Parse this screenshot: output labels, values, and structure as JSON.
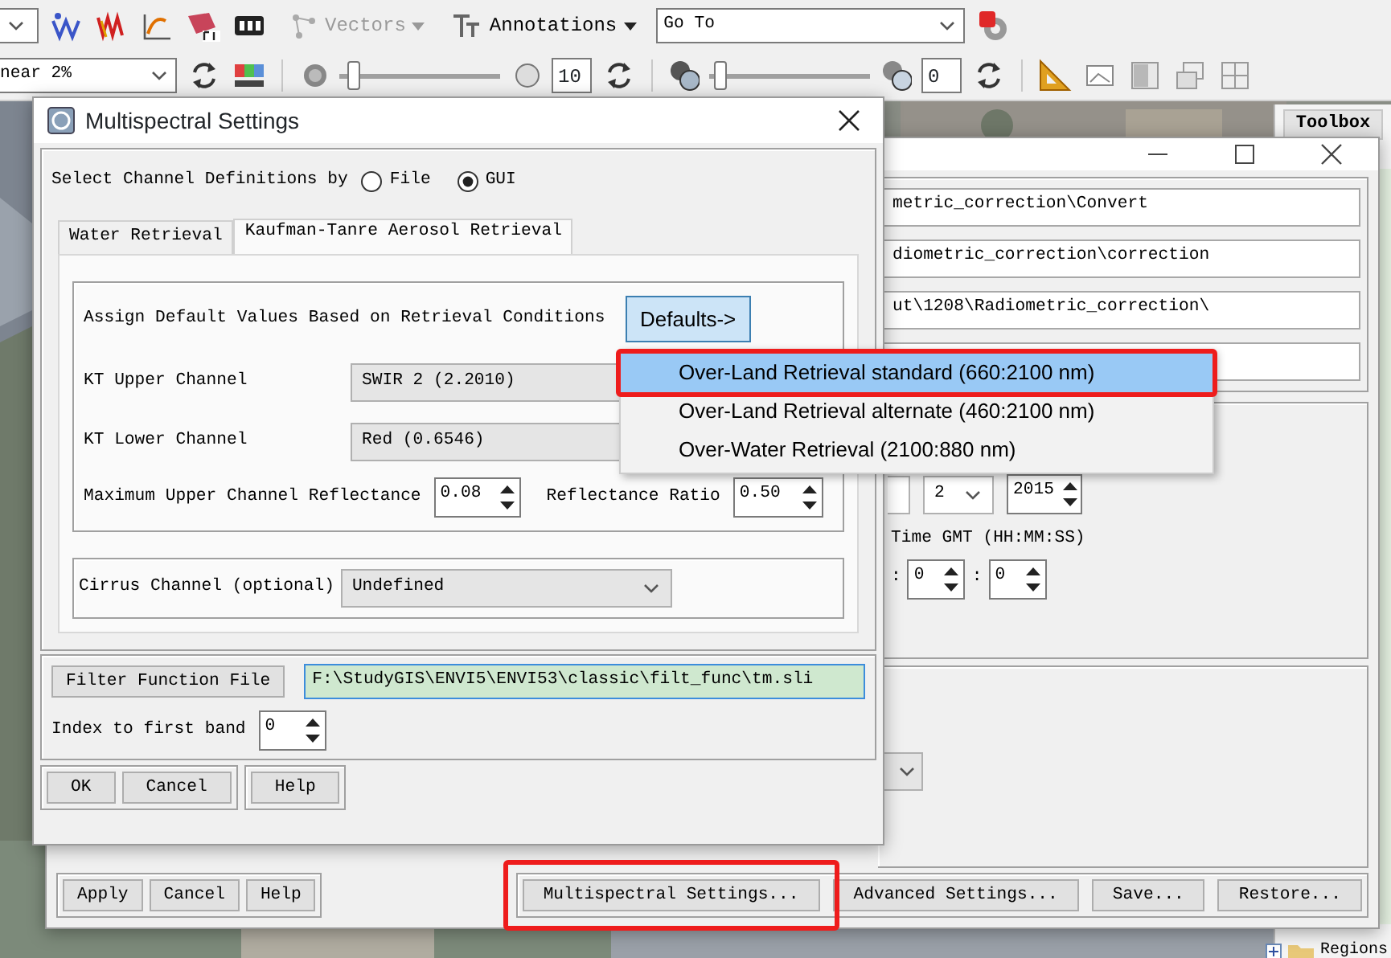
{
  "toolbar": {
    "row1": {
      "vectors": {
        "label": "Vectors",
        "disabled": true
      },
      "annotations": {
        "label": "Annotations",
        "disabled": false
      },
      "goto": {
        "value": "Go To"
      }
    },
    "row2": {
      "stretch": {
        "value": "near 2%"
      },
      "sliders": [
        {
          "level": 0.05,
          "value": "10"
        },
        {
          "level": 0.03,
          "value": "0"
        }
      ]
    }
  },
  "toolbox": {
    "title": "Toolbox",
    "items": [
      {
        "label": "Regions"
      }
    ]
  },
  "main_window": {
    "fields": [
      {
        "kind": "text",
        "value": "metric_correction\\Convert"
      },
      {
        "kind": "text",
        "value": "diometric_correction\\correction"
      },
      {
        "kind": "text",
        "value": "ut\\1208\\Radiometric_correction\\"
      },
      {
        "kind": "empty"
      }
    ],
    "date": {
      "month": "2",
      "year": "2015"
    },
    "time_label": "Time GMT (HH:MM:SS)",
    "time": [
      {
        "sep": ":",
        "value": "0"
      },
      {
        "sep": ":",
        "value": "0"
      }
    ],
    "left_buttons": [
      "Apply",
      "Cancel",
      "Help"
    ],
    "right_buttons": [
      {
        "label": "Multispectral Settings...",
        "highlighted": true
      },
      {
        "label": "Advanced Settings...",
        "highlighted": false
      },
      {
        "label": "Save...",
        "highlighted": false
      },
      {
        "label": "Restore...",
        "highlighted": false
      }
    ]
  },
  "dialog": {
    "title": "Multispectral Settings",
    "select_label": "Select Channel Definitions by",
    "radios": [
      {
        "label": "File",
        "selected": false
      },
      {
        "label": "GUI",
        "selected": true
      }
    ],
    "tabs": [
      {
        "label": "Water Retrieval",
        "selected": false
      },
      {
        "label": "Kaufman-Tanre Aerosol Retrieval",
        "selected": true
      }
    ],
    "assign_label": "Assign Default Values Based on Retrieval Conditions",
    "defaults_button": "Defaults->",
    "channels": [
      {
        "label": "KT Upper Channel",
        "value": "SWIR 2 (2.2010)"
      },
      {
        "label": "KT Lower Channel",
        "value": "Red (0.6546)"
      }
    ],
    "max_reflectance": {
      "label": "Maximum Upper Channel Reflectance",
      "value": "0.08"
    },
    "ratio": {
      "label": "Reflectance Ratio",
      "value": "0.50"
    },
    "cirrus": {
      "label": "Cirrus Channel (optional)",
      "value": "Undefined"
    },
    "filter_button": "Filter Function File",
    "filter_value": "F:\\StudyGIS\\ENVI5\\ENVI53\\classic\\filt_func\\tm.sli",
    "index": {
      "label": "Index to first band",
      "value": "0"
    },
    "buttons": [
      "OK",
      "Cancel",
      "Help"
    ]
  },
  "popup": {
    "items": [
      {
        "label": "Over-Land Retrieval standard (660:2100 nm)",
        "selected": true,
        "highlighted": true
      },
      {
        "label": "Over-Land Retrieval alternate (460:2100 nm)",
        "selected": false,
        "highlighted": false
      },
      {
        "label": "Over-Water Retrieval (2100:880 nm)",
        "selected": false,
        "highlighted": false
      }
    ]
  }
}
